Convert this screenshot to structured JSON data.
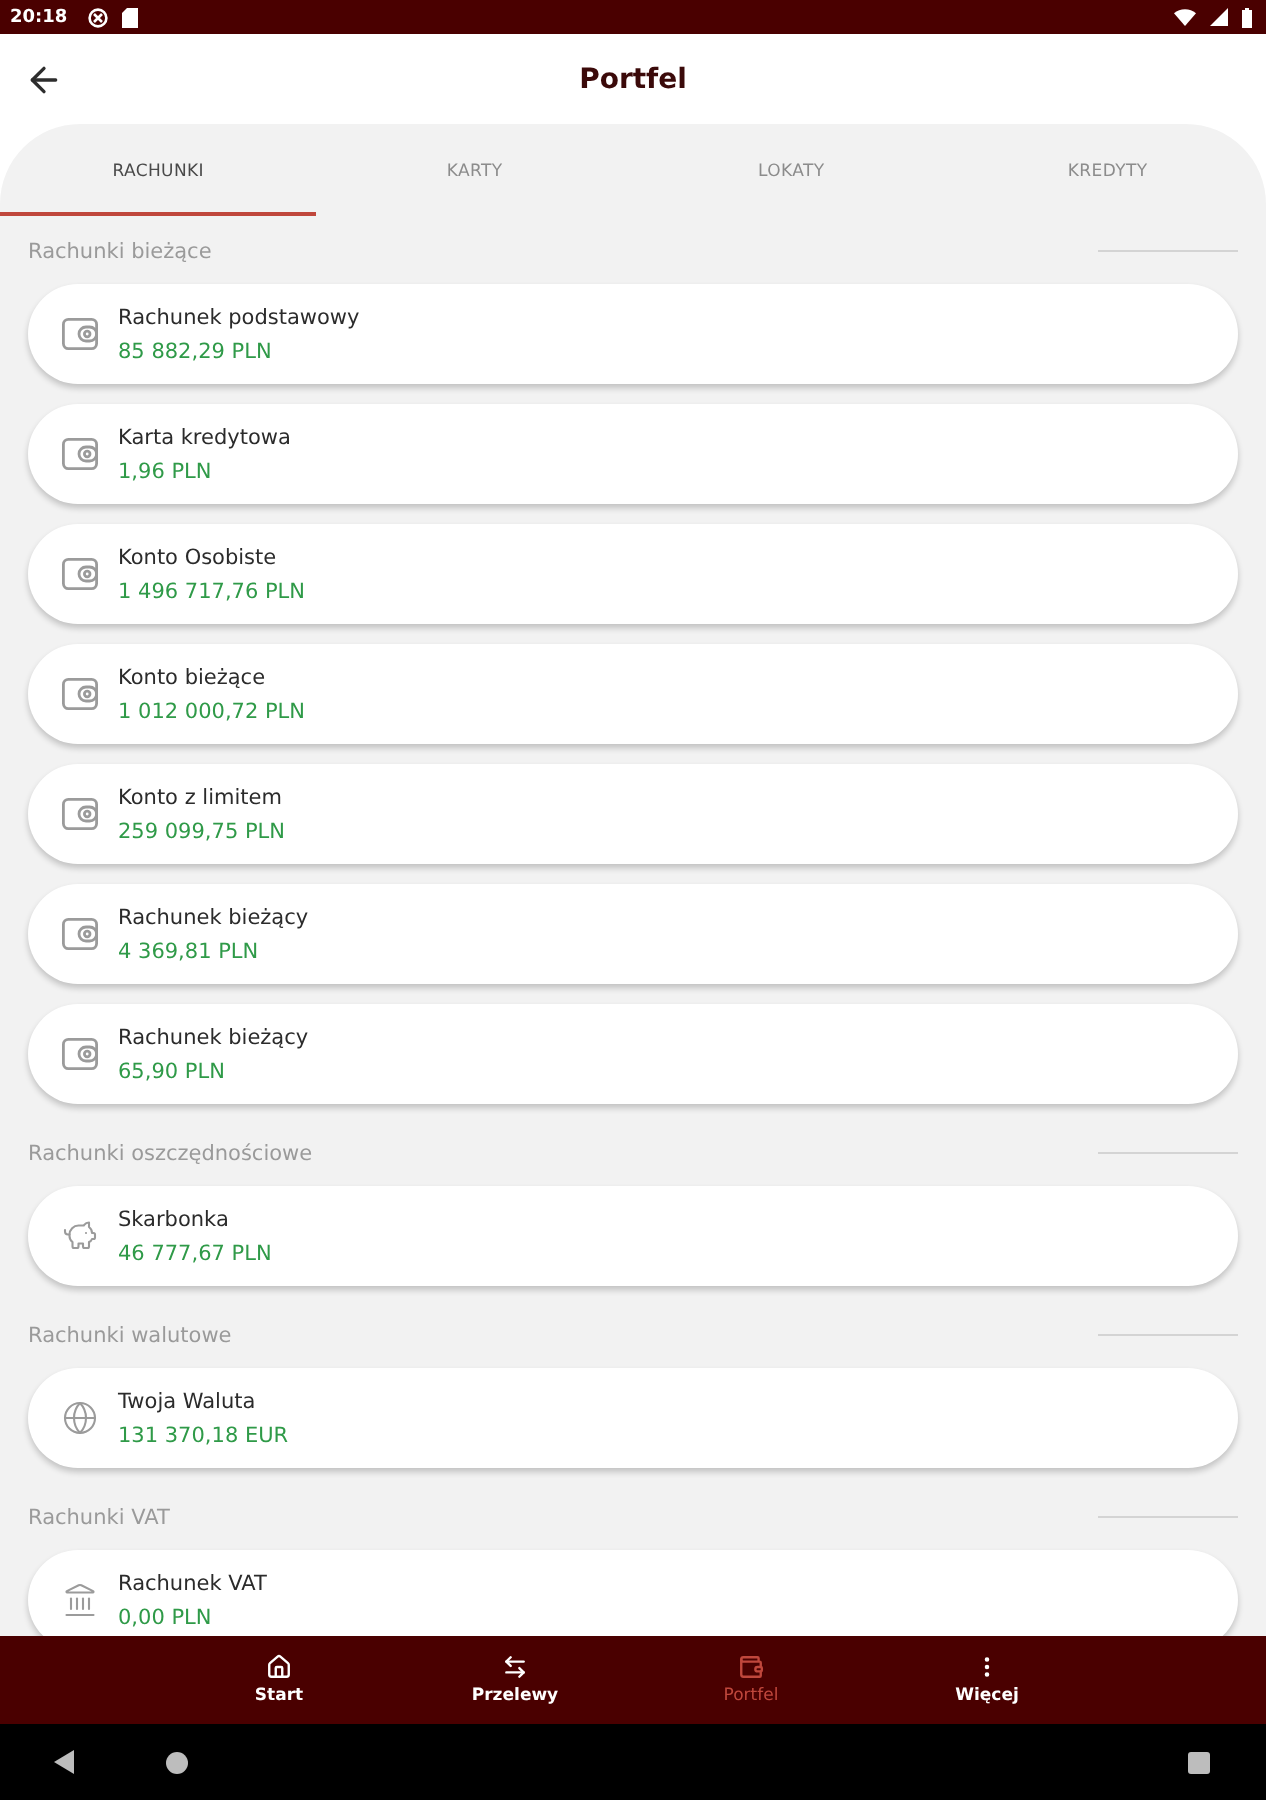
{
  "status_bar": {
    "time": "20:18"
  },
  "header": {
    "title": "Portfel"
  },
  "tabs": [
    {
      "label": "RACHUNKI",
      "selected": true
    },
    {
      "label": "KARTY",
      "selected": false
    },
    {
      "label": "LOKATY",
      "selected": false
    },
    {
      "label": "KREDYTY",
      "selected": false
    }
  ],
  "sections": [
    {
      "title": "Rachunki bieżące",
      "kind": "current",
      "accounts": [
        {
          "name": "Rachunek podstawowy",
          "balance": "85 882,29 PLN"
        },
        {
          "name": "Karta kredytowa",
          "balance": "1,96 PLN"
        },
        {
          "name": "Konto Osobiste",
          "balance": "1 496 717,76 PLN"
        },
        {
          "name": "Konto bieżące",
          "balance": "1 012 000,72 PLN"
        },
        {
          "name": "Konto z limitem",
          "balance": "259 099,75 PLN"
        },
        {
          "name": "Rachunek bieżący",
          "balance": "4 369,81 PLN"
        },
        {
          "name": "Rachunek bieżący",
          "balance": "65,90 PLN"
        }
      ]
    },
    {
      "title": "Rachunki oszczędnościowe",
      "kind": "savings",
      "accounts": [
        {
          "name": "Skarbonka",
          "balance": "46 777,67 PLN"
        }
      ]
    },
    {
      "title": "Rachunki walutowe",
      "kind": "foreign",
      "accounts": [
        {
          "name": "Twoja Waluta",
          "balance": "131 370,18 EUR"
        }
      ]
    },
    {
      "title": "Rachunki VAT",
      "kind": "vat",
      "accounts": [
        {
          "name": "Rachunek VAT",
          "balance": "0,00 PLN"
        }
      ]
    }
  ],
  "bottom_nav": [
    {
      "label": "Start",
      "kind": "home",
      "selected": false
    },
    {
      "label": "Przelewy",
      "kind": "transfers",
      "selected": false
    },
    {
      "label": "Portfel",
      "kind": "wallet",
      "selected": true
    },
    {
      "label": "Więcej",
      "kind": "more",
      "selected": false
    }
  ]
}
